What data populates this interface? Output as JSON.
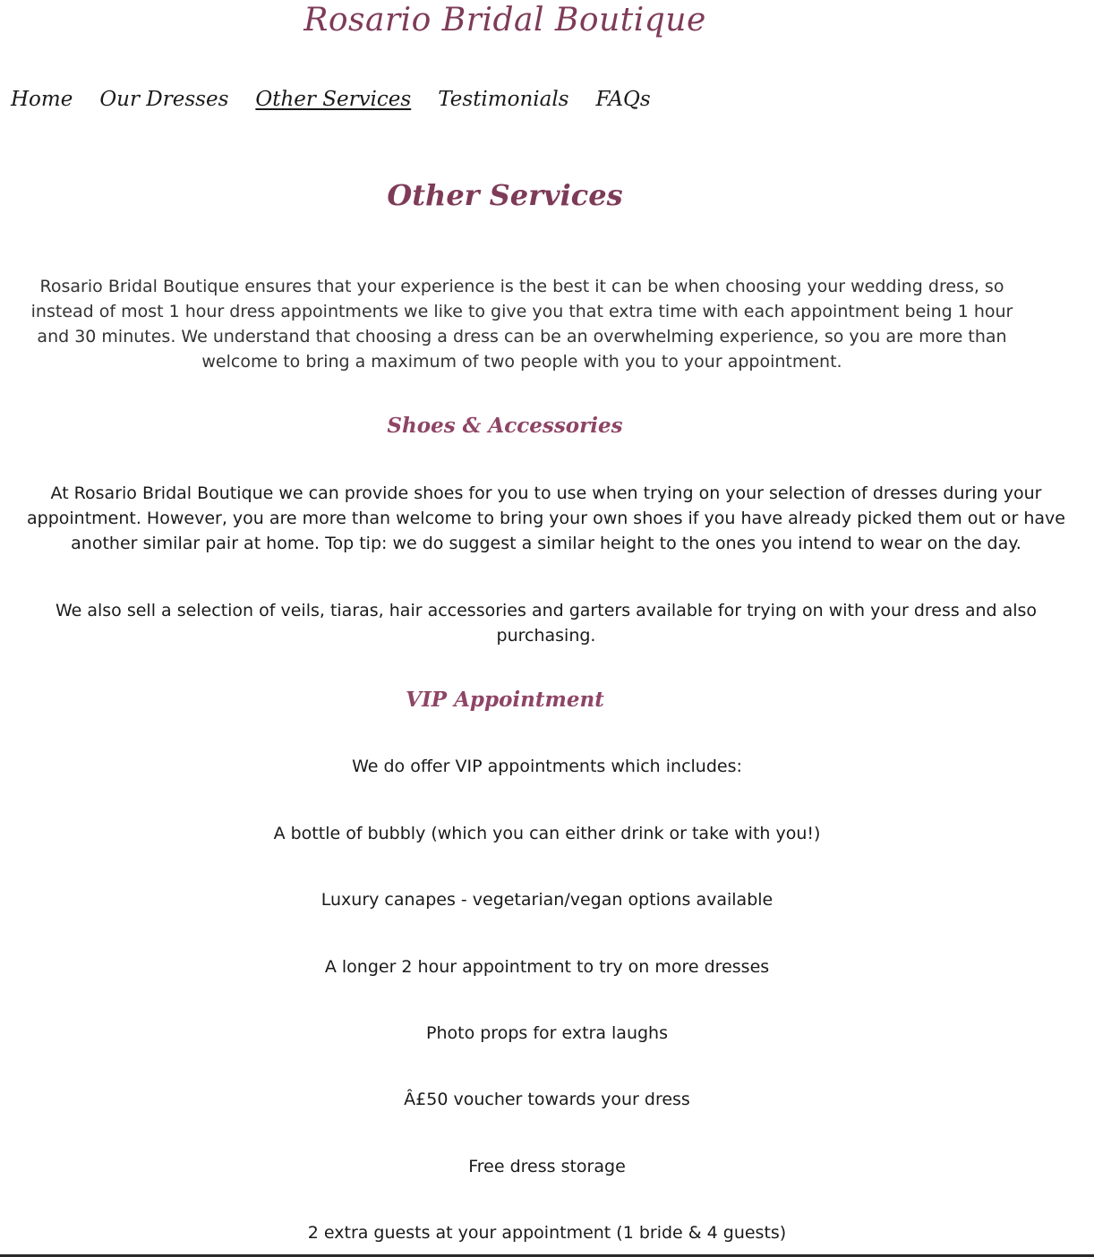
{
  "site": {
    "title": "Rosario Bridal Boutique"
  },
  "nav": {
    "items": [
      {
        "label": "Home"
      },
      {
        "label": "Our Dresses"
      },
      {
        "label": "Other Services"
      },
      {
        "label": "Testimonials"
      },
      {
        "label": "FAQs"
      }
    ],
    "active": "Other Services"
  },
  "main": {
    "heading": "Other Services",
    "intro": "Rosario Bridal Boutique ensures that your experience is the best it can be when choosing your wedding dress, so instead of most 1 hour dress appointments we like to give you that extra time with each appointment being 1 hour and 30 minutes. We understand that choosing a dress can be an overwhelming experience, so you are more than welcome to bring a maximum of two people with you to your appointment.",
    "shoes": {
      "heading": "Shoes & Accessories",
      "paragraph1": "At Rosario Bridal Boutique we can provide shoes for you to use when trying on your selection of dresses during your appointment. However, you are more than welcome to bring your own shoes if you have already picked them out or have another similar pair at home. Top tip: we do suggest a similar height to the ones you intend to wear on the day.",
      "paragraph2": "We also sell a selection of veils, tiaras, hair accessories and garters available for trying on with your dress and also purchasing."
    },
    "vip": {
      "heading": "VIP Appointment",
      "intro": "We do offer VIP appointments which includes:",
      "items": [
        "A bottle of bubbly (which you can either drink or take with you!)",
        "Luxury canapes - vegetarian/vegan options available",
        "A longer 2 hour appointment to try on more dresses",
        "Photo props for extra laughs",
        "Â£50 voucher towards your dress",
        "Free dress storage",
        "2 extra guests at your appointment (1 bride & 4 guests)"
      ]
    }
  },
  "colors": {
    "brand": "#7e3b58",
    "section_heading": "#8e4566",
    "text": "#1a1a1a"
  }
}
